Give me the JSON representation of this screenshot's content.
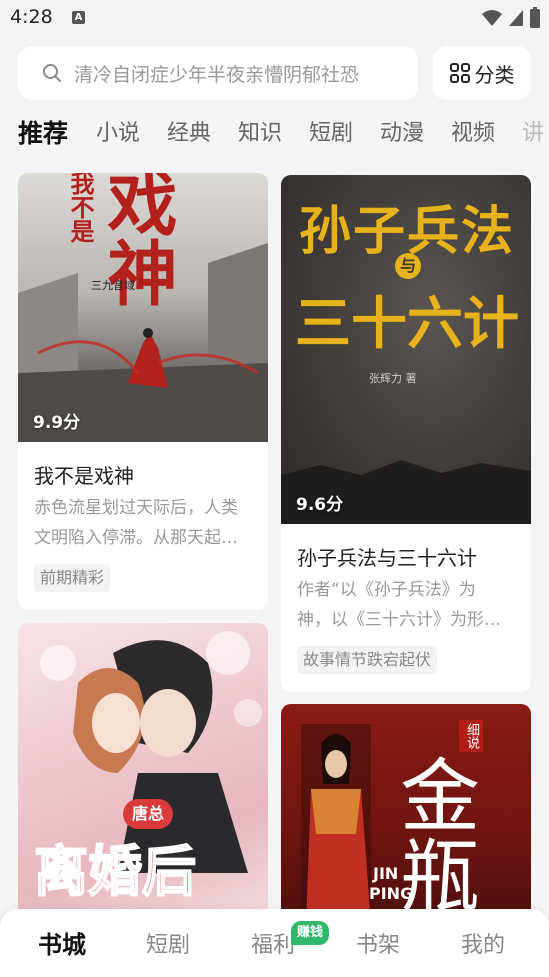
{
  "status_bar": {
    "time": "4:28",
    "notification_icon": "a-icon",
    "icons": [
      "wifi-icon",
      "signal-icon",
      "battery-icon"
    ]
  },
  "search": {
    "placeholder": "清冷自闭症少年半夜亲懵阴郁社恐",
    "icon": "search-icon"
  },
  "category_button": {
    "label": "分类",
    "icon": "grid-icon"
  },
  "tabs": [
    {
      "label": "推荐",
      "active": true
    },
    {
      "label": "小说"
    },
    {
      "label": "经典"
    },
    {
      "label": "知识"
    },
    {
      "label": "短剧"
    },
    {
      "label": "动漫"
    },
    {
      "label": "视频"
    },
    {
      "label": "讲"
    }
  ],
  "cards": [
    {
      "title": "我不是戏神",
      "score": "9.9分",
      "desc_lines": [
        "赤色流星划过天际后，人类",
        "文明陷入停滞。从那天起…"
      ],
      "tag": "前期精彩",
      "cover_text": {
        "main": "戏神",
        "prefix": "我不是",
        "author": "三九音域"
      }
    },
    {
      "title": "孙子兵法与三十六计",
      "score": "9.6分",
      "desc_lines": [
        "作者“以《孙子兵法》为",
        "神，以《三十六计》为形…"
      ],
      "tag": "故事情节跌宕起伏",
      "cover_text": {
        "line1": "孙子兵法",
        "connector": "与",
        "line2": "三十六计",
        "author": "张辉力 著"
      }
    },
    {
      "title": "离婚后",
      "cover_text": {
        "main": "离婚后",
        "badge": "唐总"
      }
    },
    {
      "title": "金瓶梅",
      "cover_text": {
        "main": "金瓶",
        "badge": "细说",
        "pinyin1": "JIN",
        "pinyin2": "PING"
      }
    }
  ],
  "bottom_nav": [
    {
      "label": "书城",
      "active": true
    },
    {
      "label": "短剧"
    },
    {
      "label": "福利"
    },
    {
      "label": "书架"
    },
    {
      "label": "我的"
    }
  ],
  "nav_badge": "赚钱",
  "colors": {
    "accent_green": "#2fb86a",
    "cover1_red": "#b3211c",
    "cover2_gold": "#e8b21a",
    "cover3_red": "#d93b3b"
  }
}
